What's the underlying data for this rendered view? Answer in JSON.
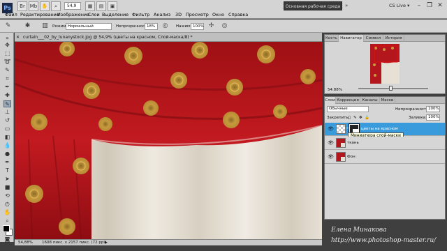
{
  "app": {
    "logo": "Ps",
    "zoom_value": "54,9"
  },
  "menu": [
    "Файл",
    "Редактирование",
    "Изображение",
    "Слои",
    "Выделение",
    "Фильтр",
    "Анализ",
    "3D",
    "Просмотр",
    "Окно",
    "Справка"
  ],
  "workspace": {
    "label": "Основная рабочая среда",
    "cs_live": "CS Live"
  },
  "options_bar": {
    "mode_label": "Режим:",
    "mode_value": "Нормальный",
    "opacity_label": "Непрозрачность:",
    "opacity_value": "18%",
    "pressure_label": "Нажим:",
    "pressure_value": "100%"
  },
  "document": {
    "tab_title": "curtain___02_by_lunanystock.jpg @ 54,9% (цветы на красном, Слой-маска/8) *",
    "status_zoom": "54,88%",
    "status_info": "1608 пикс. x 2157 пикс. (72 ppi)"
  },
  "navigator_panel": {
    "tabs": [
      "Кисть",
      "Навигатор",
      "Символ",
      "История"
    ],
    "active_tab": "Навигатор",
    "zoom": "54.88%"
  },
  "layers_panel": {
    "tabs": [
      "Слои",
      "Коррекция",
      "Каналы",
      "Маски"
    ],
    "active_tab": "Слои",
    "blend_mode": "Обычные",
    "opacity_label": "Непрозрачность:",
    "opacity_value": "100%",
    "lock_label": "Закрепить:",
    "fill_label": "Заливка:",
    "fill_value": "100%",
    "layers": [
      {
        "name": "цветы на красном",
        "selected": true
      },
      {
        "name": "ткань",
        "selected": false
      },
      {
        "name": "Фон",
        "selected": false
      }
    ],
    "tooltip": "Миниатюра слой-маски"
  },
  "watermark": {
    "author": "Елена Минакова",
    "site": "http://www.photoshop-master.ru/"
  },
  "colors": {
    "curtain_red": "#b3161c",
    "flower_gold": "#c79a3d",
    "drape_white": "#e8e3d8",
    "selection_blue": "#3a9bdc"
  }
}
